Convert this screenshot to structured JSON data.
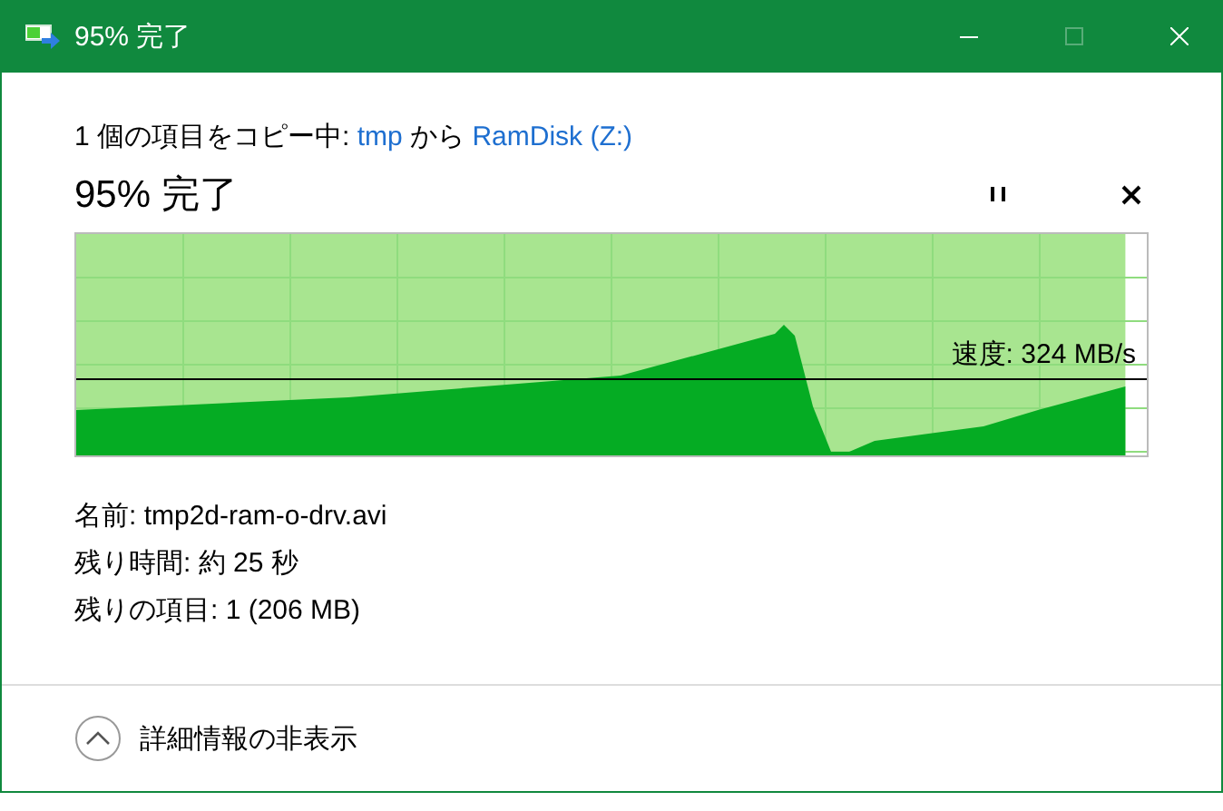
{
  "window": {
    "title": "95% 完了"
  },
  "title_buttons": [
    {
      "kind": "minimize",
      "disabled": false
    },
    {
      "kind": "maximize",
      "disabled": true
    },
    {
      "kind": "close",
      "disabled": false
    }
  ],
  "status": [
    {
      "kind": "plain",
      "text": "1 個の項目をコピー中: "
    },
    {
      "kind": "link",
      "text": "tmp"
    },
    {
      "kind": "plain",
      "text": " から "
    },
    {
      "kind": "link",
      "text": "RamDisk (Z:)"
    }
  ],
  "progress": {
    "heading": "95% 完了",
    "level": 0.98,
    "speed": "速度: 324 MB/s"
  },
  "details": [
    "名前: tmp2d-ram-o-drv.avi",
    "残り時間: 約 25 秒",
    "残りの項目: 1 (206 MB)"
  ],
  "toggle": {
    "label": "詳細情報の非表示",
    "expanded": true
  }
}
